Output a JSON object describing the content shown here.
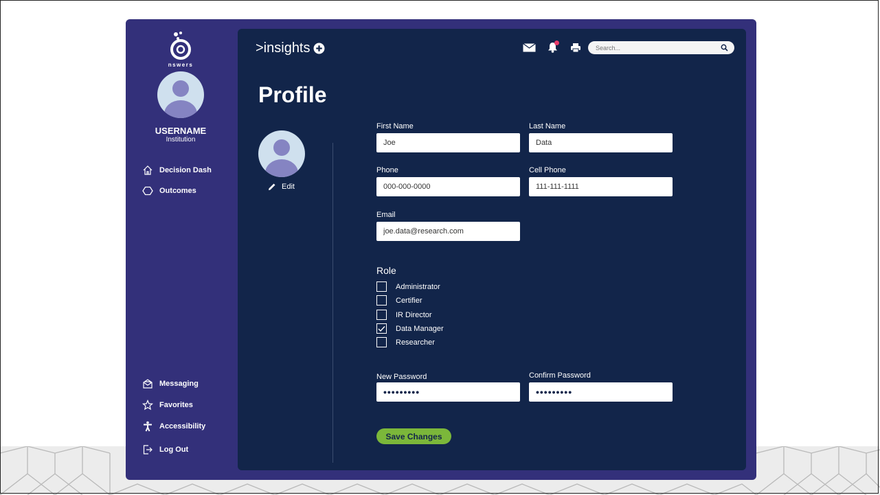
{
  "brand": {
    "logo_text": "nswers",
    "app_name": ">insights"
  },
  "user": {
    "name": "USERNAME",
    "institution": "Institution"
  },
  "sidebar": {
    "top_items": [
      {
        "label": "Decision Dash",
        "icon": "home-icon"
      },
      {
        "label": "Outcomes",
        "icon": "hexagon-icon"
      }
    ],
    "bottom_items": [
      {
        "label": "Messaging",
        "icon": "mail-open-icon"
      },
      {
        "label": "Favorites",
        "icon": "star-icon"
      },
      {
        "label": "Accessibility",
        "icon": "accessibility-icon"
      },
      {
        "label": "Log Out",
        "icon": "logout-icon"
      }
    ]
  },
  "header": {
    "search_placeholder": "Search...",
    "icons": [
      "mail-icon",
      "bell-icon",
      "print-icon",
      "search-icon"
    ],
    "notification_count": "1"
  },
  "page": {
    "title": "Profile",
    "edit_label": "Edit"
  },
  "form": {
    "first_name": {
      "label": "First Name",
      "value": "Joe"
    },
    "last_name": {
      "label": "Last Name",
      "value": "Data"
    },
    "phone": {
      "label": "Phone",
      "value": "000-000-0000"
    },
    "cell_phone": {
      "label": "Cell Phone",
      "value": "111-111-1111"
    },
    "email": {
      "label": "Email",
      "value": "joe.data@research.com"
    },
    "role_title": "Role",
    "roles": [
      {
        "label": "Administrator",
        "checked": false
      },
      {
        "label": "Certifier",
        "checked": false
      },
      {
        "label": "IR Director",
        "checked": false
      },
      {
        "label": "Data Manager",
        "checked": true
      },
      {
        "label": "Researcher",
        "checked": false
      }
    ],
    "new_password": {
      "label": "New Password",
      "value": "•••••••••"
    },
    "confirm_password": {
      "label": "Confirm Password",
      "value": "•••••••••"
    },
    "save_label": "Save Changes"
  },
  "colors": {
    "frame": "#33307a",
    "panel": "#12254a",
    "accent_green": "#7bb73a",
    "notification": "#e83c6a",
    "avatar_bg": "#cfe0ee",
    "avatar_figure": "#8584c2"
  }
}
